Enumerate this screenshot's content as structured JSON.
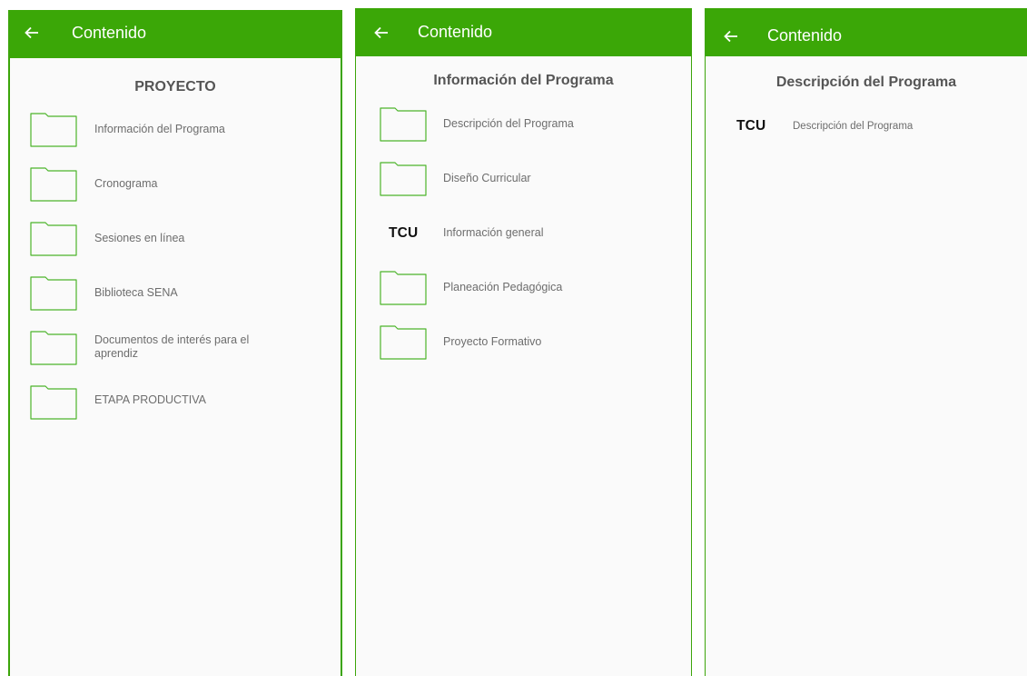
{
  "colors": {
    "appbar": "#3ba707",
    "folder_stroke": "#4cb52a",
    "panel_bg": "#fafafa"
  },
  "panels": [
    {
      "title": "Contenido",
      "back_icon": "arrow-left-icon",
      "section": "PROYECTO",
      "items": [
        {
          "type": "folder",
          "label": "Información del Programa"
        },
        {
          "type": "folder",
          "label": "Cronograma"
        },
        {
          "type": "folder",
          "label": "Sesiones en línea"
        },
        {
          "type": "folder",
          "label": "Biblioteca SENA"
        },
        {
          "type": "folder",
          "label": "Documentos de interés para el aprendiz"
        },
        {
          "type": "folder",
          "label": "ETAPA PRODUCTIVA"
        }
      ]
    },
    {
      "title": "Contenido",
      "back_icon": "arrow-left-icon",
      "section": "Información del Programa",
      "items": [
        {
          "type": "folder",
          "label": "Descripción del Programa"
        },
        {
          "type": "folder",
          "label": "Diseño Curricular"
        },
        {
          "type": "file",
          "badge": "TCU",
          "label": "Información general"
        },
        {
          "type": "folder",
          "label": "Planeación Pedagógica"
        },
        {
          "type": "folder",
          "label": "Proyecto Formativo"
        }
      ]
    },
    {
      "title": "Contenido",
      "back_icon": "arrow-left-icon",
      "section": "Descripción del Programa",
      "items": [
        {
          "type": "file",
          "badge": "TCU",
          "label": "Descripción del Programa"
        }
      ]
    }
  ]
}
